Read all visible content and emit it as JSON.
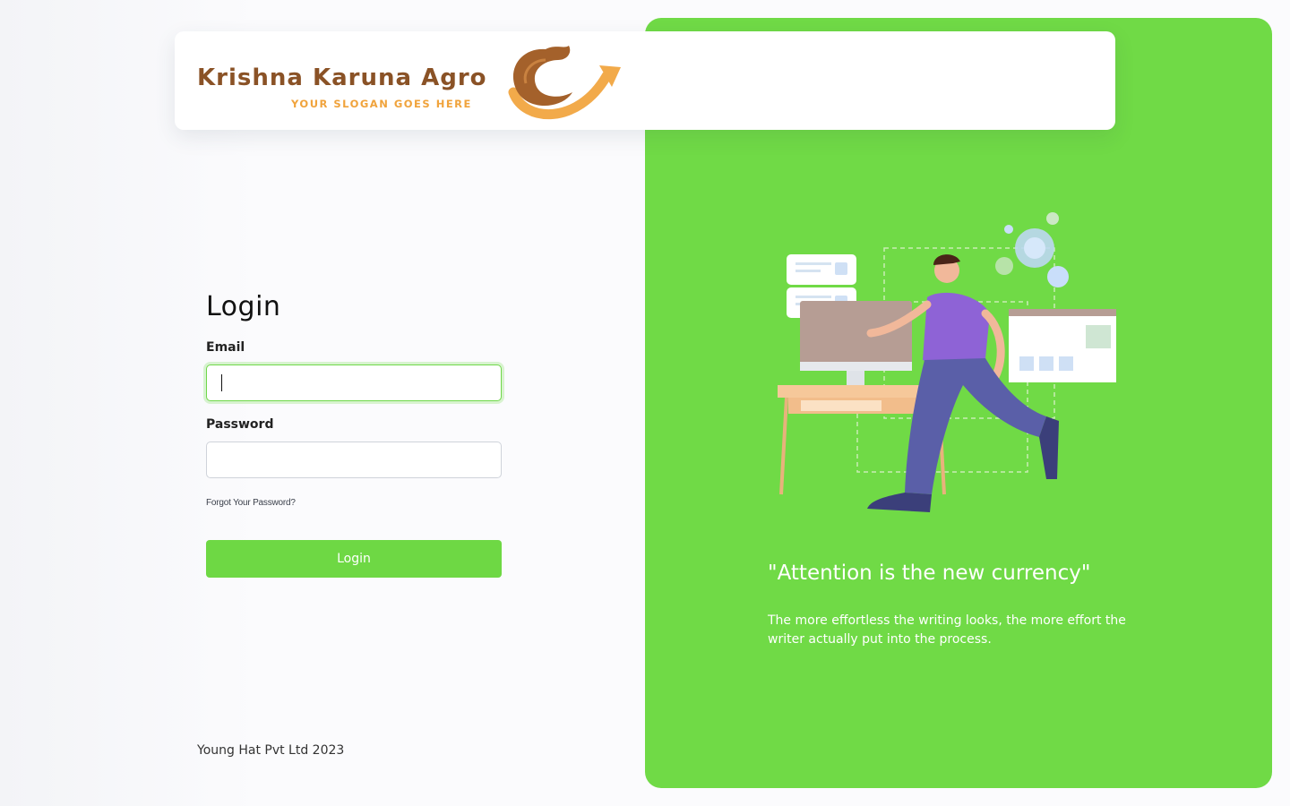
{
  "brand": {
    "name": "Krishna Karuna Agro",
    "slogan": "YOUR SLOGAN GOES HERE",
    "name_color": "#8a5226",
    "slogan_color": "#f0a33c"
  },
  "login": {
    "title": "Login",
    "email_label": "Email",
    "email_value": "",
    "password_label": "Password",
    "password_value": "",
    "forgot_link": "Forgot Your Password?",
    "submit_label": "Login"
  },
  "footer": {
    "copyright": "Young Hat Pvt Ltd 2023"
  },
  "promo": {
    "quote": "\"Attention is the new currency\"",
    "text": "The more effortless the writing looks, the more effort the writer actually put into the process."
  },
  "icons": {
    "logo_mark": "camel-arrow-logo",
    "illustration": "running-man-desk-illustration"
  },
  "colors": {
    "accent": "#70da46",
    "button": "#6ed844",
    "focus_border": "#70d84a"
  }
}
